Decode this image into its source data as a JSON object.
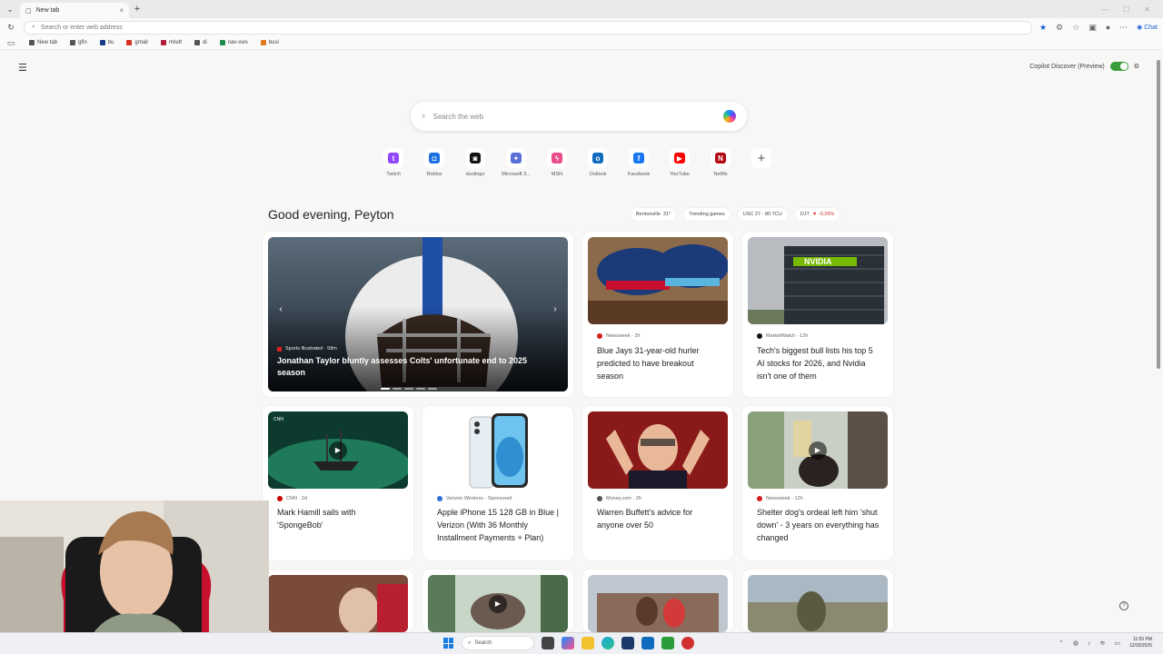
{
  "browser": {
    "tab_title": "New tab",
    "address_placeholder": "Search or enter web address",
    "bookmarks": [
      {
        "label": "New tab",
        "color": "#555555"
      },
      {
        "label": "gfin",
        "color": "#555555"
      },
      {
        "label": "bu",
        "color": "#1a3a8a"
      },
      {
        "label": "gmail",
        "color": "#d93025"
      },
      {
        "label": "mlsdt",
        "color": "#b01e3a"
      },
      {
        "label": "di",
        "color": "#555555"
      },
      {
        "label": "nav-xws",
        "color": "#1e8a4c"
      },
      {
        "label": "busl",
        "color": "#e07a1f"
      }
    ],
    "copilot_chip": "Chat"
  },
  "page": {
    "copilot_discover_label": "Copilot Discover (Preview)",
    "search_placeholder": "Search the web",
    "quick_links": [
      {
        "label": "Twitch",
        "icon": "twitch-icon",
        "color": "#9146ff",
        "glyph": "t"
      },
      {
        "label": "Roblox",
        "icon": "roblox-icon",
        "color": "#1a6ee0",
        "glyph": "◘"
      },
      {
        "label": "duolingo",
        "icon": "duolingo-icon",
        "color": "#111111",
        "glyph": "◙"
      },
      {
        "label": "Microsoft 3...",
        "icon": "microsoft365-icon",
        "color": "#5a6fd6",
        "glyph": "✦"
      },
      {
        "label": "MSN",
        "icon": "msn-icon",
        "color": "#e84d8a",
        "glyph": "ϟ"
      },
      {
        "label": "Outlook",
        "icon": "outlook-icon",
        "color": "#0f6cbd",
        "glyph": "o"
      },
      {
        "label": "Facebook",
        "icon": "facebook-icon",
        "color": "#1877f2",
        "glyph": "f"
      },
      {
        "label": "YouTube",
        "icon": "youtube-icon",
        "color": "#ff0000",
        "glyph": "▶"
      },
      {
        "label": "Netflix",
        "icon": "netflix-icon",
        "color": "#b20710",
        "glyph": "N"
      }
    ],
    "greeting": "Good evening, Peyton",
    "chips": [
      {
        "label": "Bentonville",
        "value": "31°"
      },
      {
        "label": "Trending games",
        "value": ""
      },
      {
        "label": "USC 27 - 80 TCU",
        "value": ""
      },
      {
        "label": "DJT",
        "value": "▼ -0.26%"
      }
    ]
  },
  "cards": {
    "hero": {
      "source": "Sports Illustrated · 58m",
      "title": "Jonathan Taylor bluntly assesses Colts' unfortunate end to 2025 season"
    },
    "c1": {
      "source": "Newsweek · 2h",
      "title": "Blue Jays 31-year-old hurler predicted to have breakout season",
      "source_color": "#d02020"
    },
    "c2": {
      "source": "MarketWatch · 12h",
      "title": "Tech's biggest bull lists his top 5 AI stocks for 2026, and Nvidia isn't one of them",
      "source_color": "#111111"
    },
    "c3": {
      "source": "CNN · 2d",
      "title": "Mark Hamill sails with 'SpongeBob'",
      "source_color": "#cc0000"
    },
    "c4": {
      "source": "Verizon Wireless · Sponsored",
      "title": "Apple iPhone 15 128 GB in Blue | Verizon (With 36 Monthly Installment Payments + Plan)",
      "source_color": "#2f6fd6"
    },
    "c5": {
      "source": "Money.com · 2h",
      "title": "Warren Buffett's advice for anyone over 50",
      "source_color": "#555555"
    },
    "c6": {
      "source": "Newsweek · 12h",
      "title": "Shelter dog's ordeal left him 'shut down' - 3 years on everything has changed",
      "source_color": "#d02020"
    }
  },
  "taskbar": {
    "search_label": "Search",
    "time": "11:55 PM",
    "date": "12/30/2025"
  }
}
